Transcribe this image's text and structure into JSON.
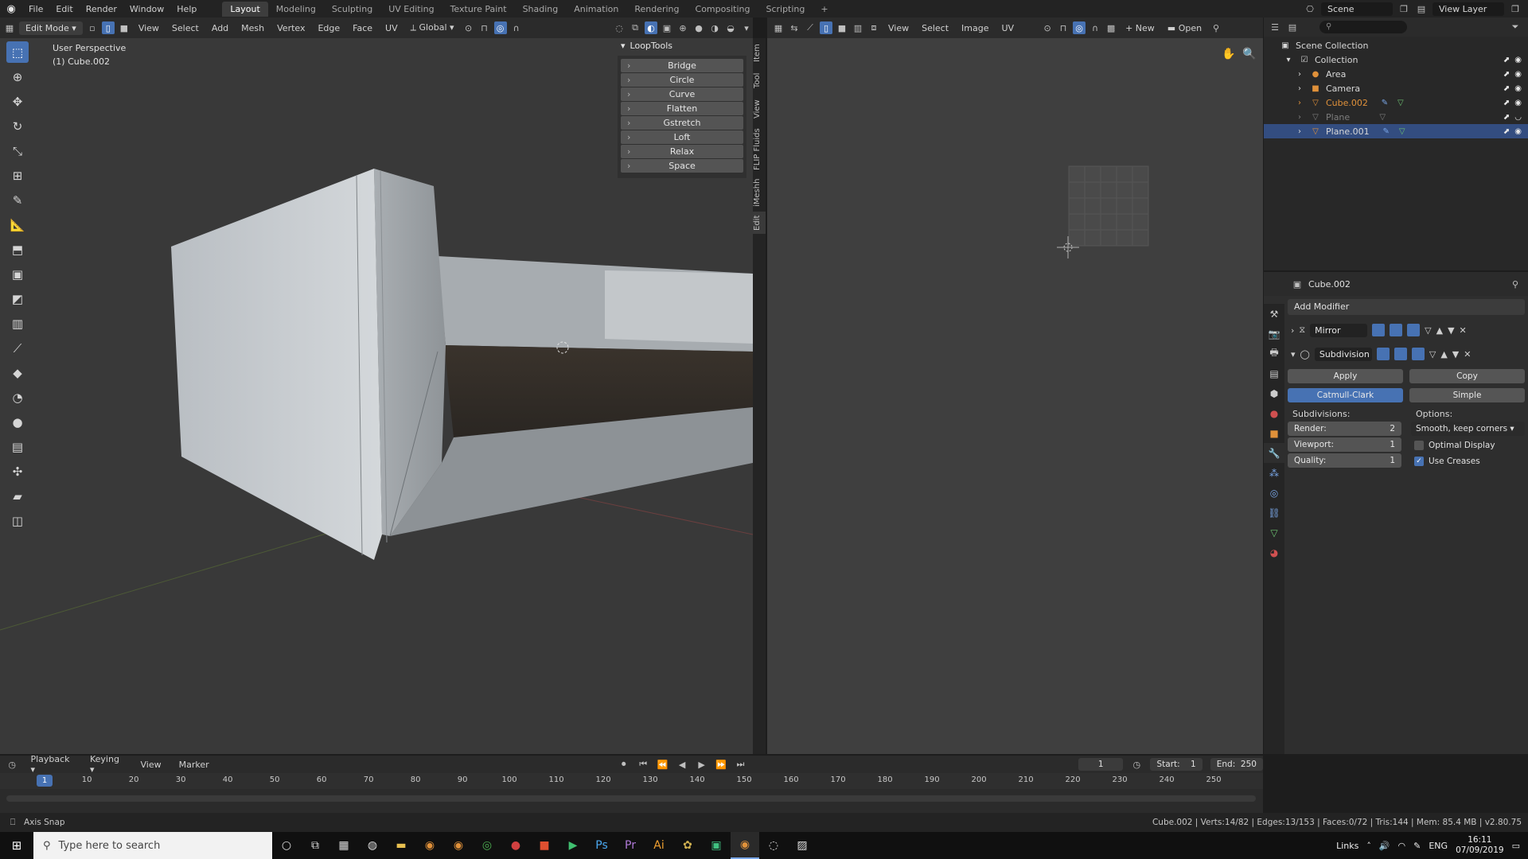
{
  "topbar": {
    "menus": [
      "File",
      "Edit",
      "Render",
      "Window",
      "Help"
    ],
    "workspaces": [
      "Layout",
      "Modeling",
      "Sculpting",
      "UV Editing",
      "Texture Paint",
      "Shading",
      "Animation",
      "Rendering",
      "Compositing",
      "Scripting"
    ],
    "active_workspace": "Layout",
    "add_symbol": "+",
    "scene": "Scene",
    "view_layer": "View Layer"
  },
  "viewport": {
    "mode": "Edit Mode",
    "menus": [
      "View",
      "Select",
      "Add",
      "Mesh",
      "Vertex",
      "Edge",
      "Face",
      "UV"
    ],
    "orientation": "Global",
    "perspective_label": "User Perspective",
    "object_label": "(1) Cube.002"
  },
  "looptools": {
    "title": "LoopTools",
    "items": [
      "Bridge",
      "Circle",
      "Curve",
      "Flatten",
      "Gstretch",
      "Loft",
      "Relax",
      "Space"
    ]
  },
  "side_tabs": [
    "Item",
    "Tool",
    "View",
    "FLIP Fluids",
    "iMeshh",
    "Edit"
  ],
  "uv_editor": {
    "menus": [
      "View",
      "Select",
      "Image",
      "UV"
    ],
    "new_label": "New",
    "open_label": "Open"
  },
  "outliner": {
    "root": "Scene Collection",
    "collection": "Collection",
    "items": [
      {
        "name": "Area",
        "color": "#e0913a"
      },
      {
        "name": "Camera",
        "color": "#e0913a"
      },
      {
        "name": "Cube.002",
        "color": "#e0913a"
      },
      {
        "name": "Plane",
        "color": "#7d7d7d"
      },
      {
        "name": "Plane.001",
        "color": "#e0913a"
      }
    ]
  },
  "properties": {
    "object": "Cube.002",
    "add_modifier": "Add Modifier",
    "modifiers": [
      "Mirror",
      "Subdivision"
    ],
    "apply_label": "Apply",
    "copy_label": "Copy",
    "catmull_label": "Catmull-Clark",
    "simple_label": "Simple",
    "subdivisions_label": "Subdivisions:",
    "options_label": "Options:",
    "render_label": "Render:",
    "render_value": "2",
    "viewport_label": "Viewport:",
    "viewport_value": "1",
    "quality_label": "Quality:",
    "quality_value": "1",
    "uv_smooth": "Smooth, keep corners",
    "optimal_display": "Optimal Display",
    "use_creases": "Use Creases"
  },
  "timeline": {
    "menus": [
      "Playback",
      "Keying",
      "View",
      "Marker"
    ],
    "current_frame": "1",
    "start_label": "Start:",
    "start_value": "1",
    "end_label": "End:",
    "end_value": "250",
    "ticks": [
      "10",
      "20",
      "30",
      "40",
      "50",
      "60",
      "70",
      "80",
      "90",
      "100",
      "110",
      "120",
      "130",
      "140",
      "150",
      "160",
      "170",
      "180",
      "190",
      "200",
      "210",
      "220",
      "230",
      "240",
      "250"
    ]
  },
  "status": {
    "left": "Axis Snap",
    "stats": "Cube.002 | Verts:14/82 | Edges:13/153 | Faces:0/72 | Tris:144 | Mem: 85.4 MB | v2.80.75"
  },
  "taskbar": {
    "search_placeholder": "Type here to search",
    "links": "Links",
    "lang": "ENG",
    "time": "16:11",
    "date": "07/09/2019"
  }
}
